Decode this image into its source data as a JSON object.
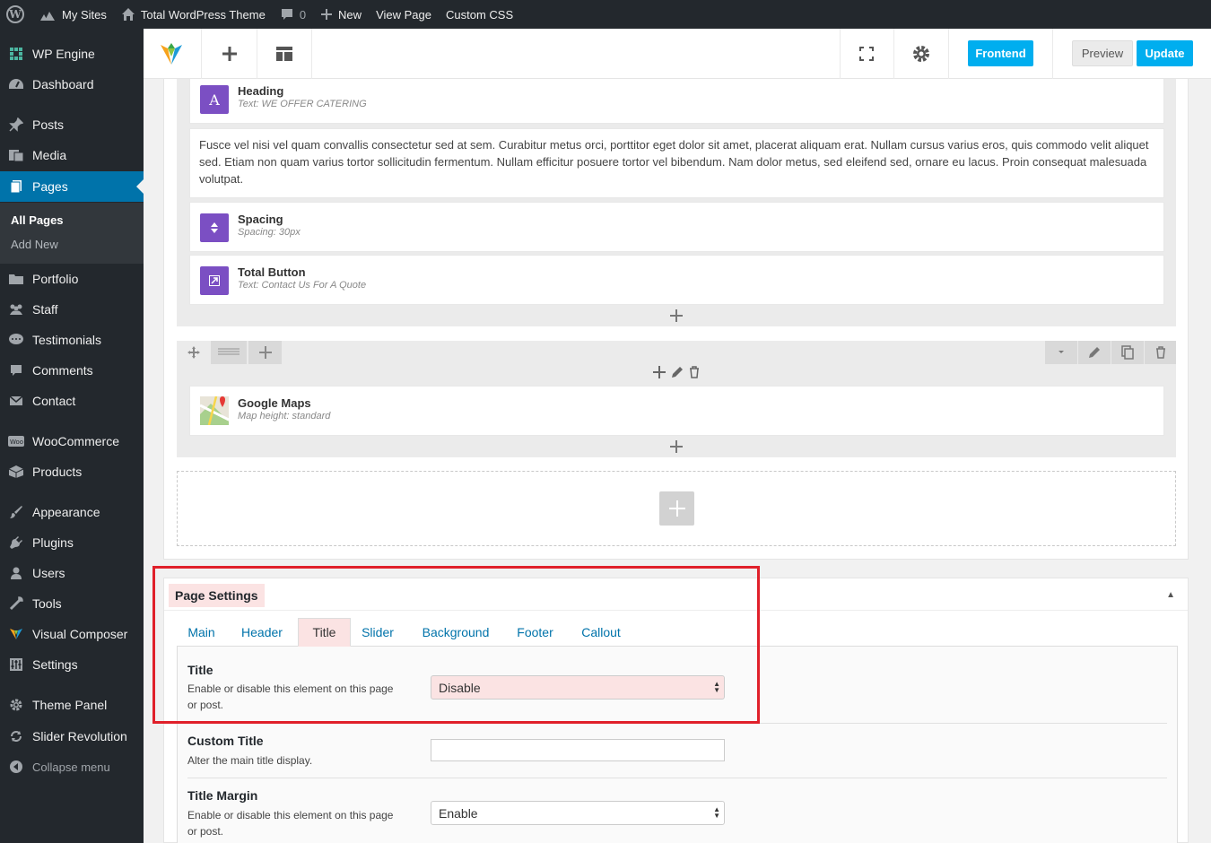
{
  "adminbar": {
    "my_sites": "My Sites",
    "site_name": "Total WordPress Theme",
    "comments_count": "0",
    "new_label": "New",
    "view_page": "View Page",
    "custom_css": "Custom CSS"
  },
  "sidebar": {
    "items": [
      {
        "label": "WP Engine",
        "icon": "wp-engine-icon"
      },
      {
        "label": "Dashboard",
        "icon": "dashboard-icon"
      },
      {
        "label": "Posts",
        "icon": "pin-icon"
      },
      {
        "label": "Media",
        "icon": "media-icon"
      },
      {
        "label": "Pages",
        "icon": "pages-icon"
      },
      {
        "label": "Portfolio",
        "icon": "folder-icon"
      },
      {
        "label": "Staff",
        "icon": "staff-icon"
      },
      {
        "label": "Testimonials",
        "icon": "speech-bubble-icon"
      },
      {
        "label": "Comments",
        "icon": "comment-icon"
      },
      {
        "label": "Contact",
        "icon": "mail-icon"
      },
      {
        "label": "WooCommerce",
        "icon": "woo-icon"
      },
      {
        "label": "Products",
        "icon": "products-icon"
      },
      {
        "label": "Appearance",
        "icon": "brush-icon"
      },
      {
        "label": "Plugins",
        "icon": "plugin-icon"
      },
      {
        "label": "Users",
        "icon": "user-icon"
      },
      {
        "label": "Tools",
        "icon": "wrench-icon"
      },
      {
        "label": "Visual Composer",
        "icon": "vc-icon"
      },
      {
        "label": "Settings",
        "icon": "settings-icon"
      },
      {
        "label": "Theme Panel",
        "icon": "gear-icon"
      },
      {
        "label": "Slider Revolution",
        "icon": "refresh-icon"
      },
      {
        "label": "Collapse menu",
        "icon": "collapse-icon"
      }
    ],
    "submenu": {
      "all_pages": "All Pages",
      "add_new": "Add New"
    }
  },
  "toolbar": {
    "frontend": "Frontend",
    "preview": "Preview",
    "update": "Update"
  },
  "elements": {
    "heading": {
      "title": "Heading",
      "sub": "Text: WE OFFER CATERING",
      "icon_letter": "A"
    },
    "text_block": "Fusce vel nisi vel quam convallis consectetur sed at sem. Curabitur metus orci, porttitor eget dolor sit amet, placerat aliquam erat. Nullam cursus varius eros, quis commodo velit aliquet sed. Etiam non quam varius tortor sollicitudin fermentum. Nullam efficitur posuere tortor vel bibendum. Nam dolor metus, sed eleifend sed, ornare eu lacus. Proin consequat malesuada volutpat.",
    "spacing": {
      "title": "Spacing",
      "sub": "Spacing: 30px"
    },
    "button": {
      "title": "Total Button",
      "sub": "Text: Contact Us For A Quote"
    },
    "maps": {
      "title": "Google Maps",
      "sub": "Map height: standard"
    }
  },
  "page_settings": {
    "title": "Page Settings",
    "tabs": [
      "Main",
      "Header",
      "Title",
      "Slider",
      "Background",
      "Footer",
      "Callout"
    ],
    "active_tab": "Title",
    "fields": [
      {
        "label": "Title",
        "desc": "Enable or disable this element on this page or post.",
        "value": "Disable"
      },
      {
        "label": "Custom Title",
        "desc": "Alter the main title display.",
        "value": ""
      },
      {
        "label": "Title Margin",
        "desc": "Enable or disable this element on this page or post.",
        "value": "Enable"
      }
    ]
  },
  "colors": {
    "admin_dark": "#23282d",
    "wp_blue": "#0073aa",
    "vc_blue": "#00aeef",
    "element_purple": "#7b4fc3",
    "highlight_red": "#e0202a",
    "tab_pink": "#fbe3e3"
  }
}
